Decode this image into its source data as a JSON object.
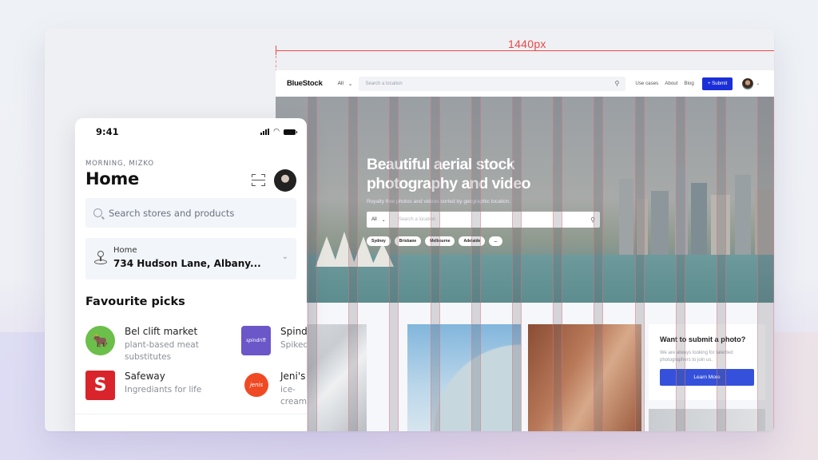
{
  "measure": {
    "label": "1440px",
    "color": "#ef4a4a"
  },
  "desktop": {
    "nav": {
      "logo": "BlueStock",
      "filter": "All",
      "search_placeholder": "Search a location",
      "links": [
        "Use cases",
        "About",
        "Blog"
      ],
      "submit_label": "+ Submit",
      "accent": "#1a2fd8"
    },
    "hero": {
      "title_line1": "Beautiful aerial stock",
      "title_line2": "photography and video",
      "subtitle": "Royalty free photos and videos sorted by geographic location.",
      "filter": "All",
      "search_placeholder": "Search a location",
      "chips": [
        "Sydney",
        "Brisbane",
        "Melbourne",
        "Adelaide",
        "..."
      ]
    },
    "cta": {
      "title": "Want to submit a photo?",
      "text": "We are always looking for talented photographers to join us.",
      "button": "Learn More",
      "accent": "#3551db"
    },
    "grid_columns": 12
  },
  "mobile": {
    "status": {
      "time": "9:41"
    },
    "greeting": "MORNING, MIZKO",
    "title": "Home",
    "search_placeholder": "Search stores and products",
    "address": {
      "label": "Home",
      "value": "734 Hudson Lane, Albany..."
    },
    "section_title": "Favourite picks",
    "picks": [
      {
        "name": "Bel clift market",
        "desc": "plant-based meat substitutes",
        "icon": "bull-logo",
        "color": "#6cbf4a"
      },
      {
        "name": "Spindrift",
        "desc": "Spiked",
        "icon": "spindrift-logo",
        "color": "#6b57c8",
        "logo_text": "spindrift"
      },
      {
        "name": "Safeway",
        "desc": "Ingrediants for life",
        "icon": "safeway-logo",
        "color": "#d9242b",
        "logo_text": "S"
      },
      {
        "name": "Jeni's",
        "desc": "ice-cream",
        "icon": "jenis-logo",
        "color": "#f04a24",
        "logo_text": "jenis"
      }
    ]
  }
}
